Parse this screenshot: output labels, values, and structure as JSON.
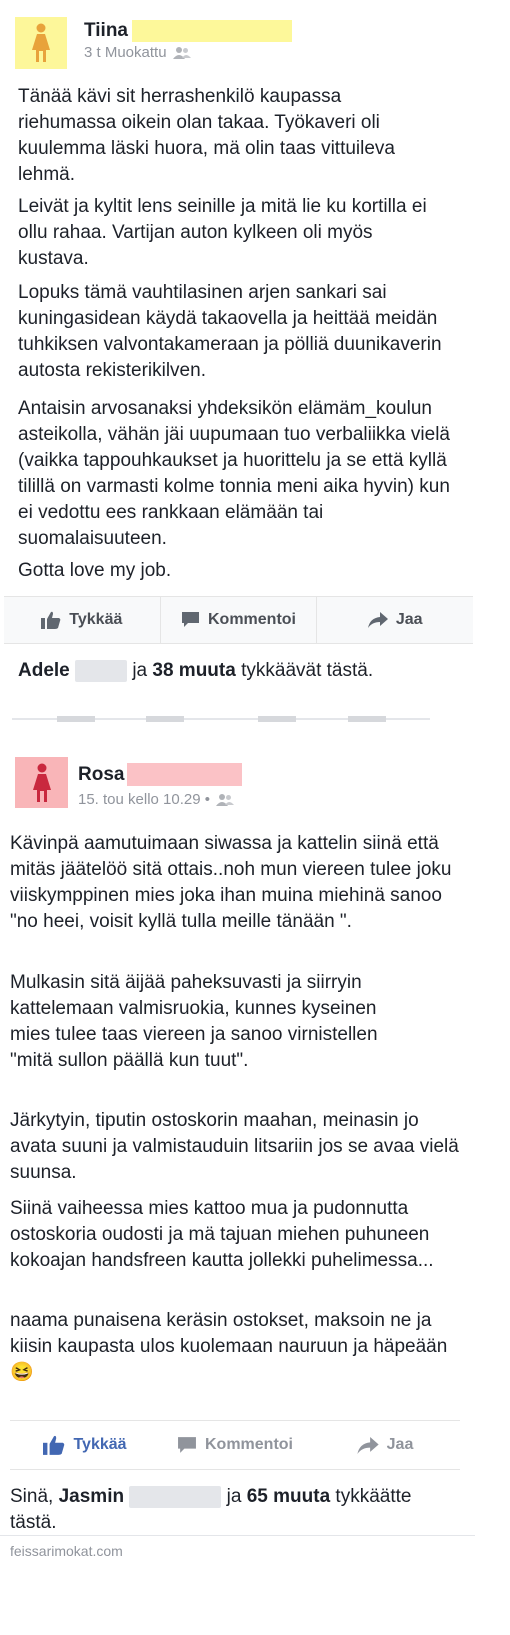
{
  "post1": {
    "author_name": "Tiina",
    "meta_text": "3 t Muokattu",
    "paragraphs": [
      "Tänää kävi sit herrashenkilö kaupassa riehumassa oikein olan takaa. Työkaveri oli kuulemma läski huora, mä olin taas vittuileva lehmä.",
      "Leivät ja kyltit lens seinille ja mitä lie ku kortilla ei ollu rahaa. Vartijan auton kylkeen oli myös kustava.",
      "Lopuks tämä vauhtilasinen arjen sankari sai kuningasidean käydä takaovella ja heittää meidän tuhkiksen valvontakameraan ja pölliä duunikaverin autosta rekisterikilven.",
      "Antaisin arvosanaksi yhdeksikön elämäm_koulun asteikolla, vähän jäi uupumaan tuo verbaliikka vielä (vaikka tappouhkaukset ja huorittelu ja se että kyllä tilillä on varmasti kolme tonnia meni aika hyvin) kun ei vedottu ees rankkaan elämään tai suomalaisuuteen.",
      "Gotta love my job."
    ],
    "actions": {
      "like": "Tykkää",
      "comment": "Kommentoi",
      "share": "Jaa"
    },
    "likes": {
      "first_name": "Adele",
      "connector": "ja",
      "others": "38 muuta",
      "suffix": "tykkäävät tästä."
    }
  },
  "post2": {
    "author_name": "Rosa",
    "meta_text": "15. tou kello 10.29 •",
    "paragraphs": [
      "Kävinpä aamutuimaan siwassa ja kattelin siinä että mitäs jäätelöö sitä ottais..noh mun viereen tulee joku viiskymppinen mies joka ihan muina miehinä sanoo \"no heei, voisit kyllä tulla meille tänään \".",
      "Mulkasin sitä äijää paheksuvasti ja siirryin kattelemaan valmisruokia, kunnes kyseinen mies tulee taas viereen ja sanoo virnistellen \"mitä sullon päällä kun tuut\".",
      "Järkytyin, tiputin ostoskorin maahan, meinasin jo avata suuni ja valmistauduin litsariin jos se avaa vielä suunsa.",
      "Siinä vaiheessa mies kattoo mua ja pudonnutta ostoskoria oudosti ja mä tajuan miehen puhuneen kokoajan handsfreen kautta jollekki puhelimessa...",
      "naama punaisena keräsin ostokset, maksoin ne ja kiisin kaupasta ulos kuolemaan nauruun ja häpeään"
    ],
    "emoji": "😆",
    "actions": {
      "like": "Tykkää",
      "comment": "Kommentoi",
      "share": "Jaa"
    },
    "likes": {
      "prefix": "Sinä,",
      "first_name": "Jasmin",
      "connector": "ja",
      "others": "65 muuta",
      "suffix": "tykkäätte tästä."
    }
  },
  "watermark": "feissarimokat.com",
  "colors": {
    "text": "#1d2129",
    "meta": "#90949c",
    "action_text": "#4b4f56",
    "like_active": "#4267b2",
    "redact_yellow": "#fdf89a",
    "redact_pink": "#fbc2c6",
    "redact_gray": "#e4e6ea",
    "avatar1_bg": "#fdf79a",
    "avatar1_fig": "#e8a33b",
    "avatar2_bg": "#f9b5b8",
    "avatar2_fig": "#c9283e"
  }
}
